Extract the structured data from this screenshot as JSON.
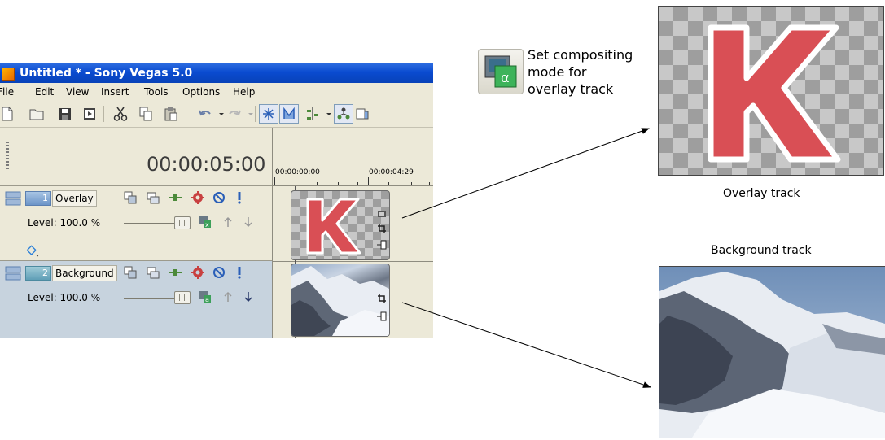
{
  "window": {
    "title": "Untitled * - Sony Vegas 5.0",
    "menus": [
      "File",
      "Edit",
      "View",
      "Insert",
      "Tools",
      "Options",
      "Help"
    ]
  },
  "toolbar": {
    "icons": [
      "new-file-icon",
      "open-folder-icon",
      "save-icon",
      "render-icon",
      "cut-icon",
      "copy-icon",
      "paste-icon",
      "undo-icon",
      "redo-icon",
      "auto-ripple-icon",
      "snapping-icon",
      "split-icon",
      "lock-envelope-icon",
      "media-icon"
    ]
  },
  "timecode": "00:00:05:00",
  "ruler": {
    "start": "00:00:00:00",
    "mark": "00:00:04:29"
  },
  "tracks": [
    {
      "number": "1",
      "name": "Overlay",
      "level": "Level: 100.0 %",
      "level_value": 100.0
    },
    {
      "number": "2",
      "name": "Background",
      "level": "Level: 100.0 %",
      "level_value": 100.0
    }
  ],
  "annotation": {
    "compositing": "Set compositing\nmode for\noverlay track",
    "overlay_label": "Overlay track",
    "background_label": "Background track"
  },
  "colors": {
    "titlebar": "#0A4BD0",
    "k_letter": "#D94F55",
    "track2_bg": "#C7D3DE"
  }
}
